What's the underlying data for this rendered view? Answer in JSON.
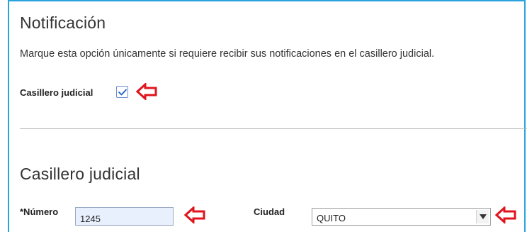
{
  "notificacion": {
    "title": "Notificación",
    "description": "Marque esta opción únicamente si requiere recibir sus notificaciones en el casillero judicial.",
    "checkbox_label": "Casillero judicial",
    "checked": true
  },
  "casillero": {
    "title": "Casillero judicial",
    "numero_label": "*Número",
    "numero_value": "1245",
    "ciudad_label": "Ciudad",
    "ciudad_selected": "QUITO"
  },
  "colors": {
    "frame_border": "#2aa3dd",
    "checkbox_border": "#6d8fcf",
    "check_mark": "#1f5fbf",
    "input_fill": "#e8f0fe",
    "annotation_arrow": "#e0141e"
  },
  "icons": {
    "check": "check-icon",
    "dropdown": "dropdown-arrow-icon",
    "annotation": "red-arrow-icon"
  }
}
